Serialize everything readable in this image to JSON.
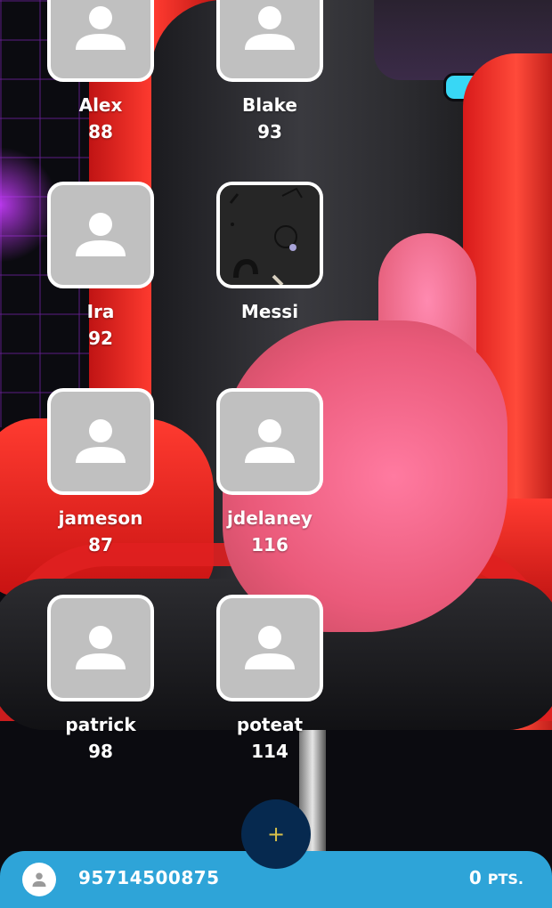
{
  "friends": [
    {
      "name": "Alex",
      "score": "88",
      "avatar": "person-icon"
    },
    {
      "name": "Blake",
      "score": "93",
      "avatar": "person-icon"
    },
    {
      "name": "Ira",
      "score": "92",
      "avatar": "person-icon"
    },
    {
      "name": "Messi",
      "score": "",
      "avatar": "photo"
    },
    {
      "name": "jameson",
      "score": "87",
      "avatar": "person-icon"
    },
    {
      "name": "jdelaney",
      "score": "116",
      "avatar": "person-icon"
    },
    {
      "name": "patrick",
      "score": "98",
      "avatar": "person-icon"
    },
    {
      "name": "poteat",
      "score": "114",
      "avatar": "person-icon"
    }
  ],
  "fab": {
    "icon": "plus-icon",
    "label": "+"
  },
  "footer": {
    "user_icon": "user-icon",
    "phone": "95714500875",
    "points_value": "0",
    "points_unit": "PTS."
  },
  "colors": {
    "footer_bg": "#2ea4d8",
    "fab_bg": "#06294f",
    "fab_icon": "#d9c14a",
    "avatar_bg": "#c0c0c0"
  }
}
